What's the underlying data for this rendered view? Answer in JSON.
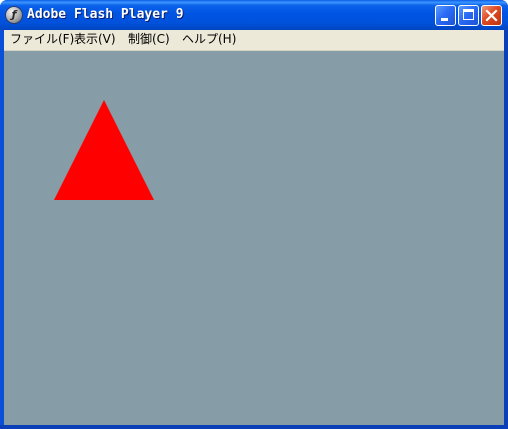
{
  "window": {
    "title": "Adobe Flash Player 9",
    "icon": "flash-player-icon"
  },
  "menubar": {
    "items": [
      {
        "label": "ファイル(F)"
      },
      {
        "label": "表示(V)"
      },
      {
        "label": "制御(C)"
      },
      {
        "label": "ヘルプ(H)"
      }
    ]
  },
  "stage": {
    "background_color": "#869ca7",
    "shape": {
      "type": "triangle",
      "color": "#ff0000"
    }
  },
  "caption_buttons": {
    "minimize_icon": "minimize-icon",
    "maximize_icon": "maximize-icon",
    "close_icon": "close-icon"
  }
}
